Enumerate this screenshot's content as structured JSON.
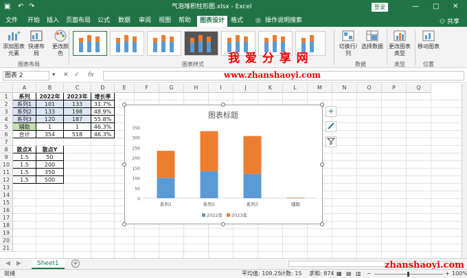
{
  "title_bar": {
    "title": "气泡堆积柱形图.xlsx - Excel",
    "login": "登录",
    "min": "—",
    "max": "□",
    "close": "✕",
    "save_icon": "save-icon",
    "undo": "↶",
    "redo": "↷"
  },
  "tabs": [
    "文件",
    "开始",
    "插入",
    "页面布局",
    "公式",
    "数据",
    "审阅",
    "视图",
    "帮助",
    "图表设计",
    "格式"
  ],
  "active_tab": "图表设计",
  "tell_me": "操作说明搜索",
  "share": "共享",
  "ribbon": {
    "add_element": "添加图表元素",
    "quick_layout": "快速布局",
    "change_colors": "更改颜色",
    "group_layout": "图表布局",
    "group_styles": "图表样式",
    "switch_row_col": "切换行/列",
    "select_data": "选择数据",
    "group_data": "数据",
    "change_type": "更改图表类型",
    "group_type": "类型",
    "move_chart": "移动图表",
    "group_location": "位置"
  },
  "watermark": {
    "main": "我 爱 分 享 网",
    "url": "www.zhanshaoyi.com",
    "url2": "zhanshaoyi.com"
  },
  "formula_bar": {
    "name_box": "图表 2",
    "cancel": "✕",
    "enter": "✓",
    "fx": "fx",
    "value": ""
  },
  "columns": [
    "A",
    "B",
    "C",
    "D",
    "E",
    "F",
    "G",
    "H",
    "I",
    "J",
    "K",
    "L",
    "M",
    "N",
    "O",
    "P",
    "Q"
  ],
  "rows": [
    "1",
    "2",
    "3",
    "4",
    "5",
    "6",
    "7",
    "8",
    "9",
    "10",
    "11",
    "12",
    "13",
    "14",
    "15",
    "16",
    "17",
    "18",
    "19",
    "20",
    "21"
  ],
  "table1": {
    "headers": [
      "系列",
      "2022年",
      "2023年",
      "增长率"
    ],
    "rows": [
      [
        "系列1",
        "101",
        "133",
        "31.7%"
      ],
      [
        "系列2",
        "133",
        "198",
        "48.9%"
      ],
      [
        "系列3",
        "120",
        "187",
        "55.8%"
      ],
      [
        "辅助",
        "1",
        "1",
        "46.3%"
      ],
      [
        "合计",
        "354",
        "518",
        "46.3%"
      ]
    ]
  },
  "table2": {
    "headers": [
      "散点X",
      "散点Y"
    ],
    "rows": [
      [
        "1.5",
        "50"
      ],
      [
        "1.5",
        "200"
      ],
      [
        "1.5",
        "350"
      ],
      [
        "1.5",
        "500"
      ]
    ]
  },
  "chart_data": {
    "type": "bar",
    "stacked": true,
    "title": "图表标题",
    "categories": [
      "系列1",
      "系列2",
      "系列3",
      "辅助"
    ],
    "series": [
      {
        "name": "2022年",
        "values": [
          101,
          133,
          120,
          1
        ],
        "color": "#5b9bd5"
      },
      {
        "name": "2023年",
        "values": [
          133,
          198,
          187,
          1
        ],
        "color": "#ed7d31"
      }
    ],
    "ylim": [
      0,
      350
    ],
    "yticks": [
      "0",
      "50",
      "100",
      "150",
      "200",
      "250",
      "300",
      "350"
    ],
    "legend": "bottom"
  },
  "chart_tools": {
    "add": "+",
    "brush": "brush-icon",
    "filter": "filter-icon"
  },
  "sheet_tab": "Sheet1",
  "status": {
    "ready": "就绪",
    "average": "平均值: 109.25",
    "count": "计数: 15",
    "sum": "求和: 874",
    "zoom": "100%"
  }
}
